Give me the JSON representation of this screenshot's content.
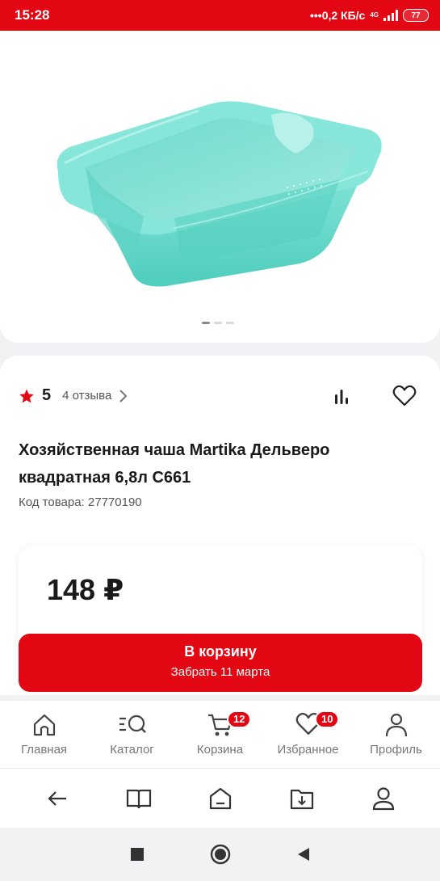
{
  "status_bar": {
    "time": "15:28",
    "speed": "•••0,2 КБ/с",
    "network": "4G",
    "battery": "77"
  },
  "gallery": {
    "image_alt": "Хозяйственная чаша бирюзовая",
    "dots": 3,
    "active_dot": 0
  },
  "product": {
    "rating": "5",
    "reviews": "4 отзыва",
    "title": "Хозяйственная чаша Martika Дельверо квадратная 6,8л С661",
    "code_label": "Код товара:",
    "code": "27770190",
    "price": "148 ₽"
  },
  "buy_button": {
    "label": "В корзину",
    "sub": "Забрать 11 марта"
  },
  "bottom_nav": [
    {
      "label": "Главная",
      "icon": "home-icon",
      "badge": ""
    },
    {
      "label": "Каталог",
      "icon": "catalog-search-icon",
      "badge": ""
    },
    {
      "label": "Корзина",
      "icon": "cart-icon",
      "badge": "12"
    },
    {
      "label": "Избранное",
      "icon": "heart-icon",
      "badge": "10"
    },
    {
      "label": "Профиль",
      "icon": "profile-icon",
      "badge": ""
    }
  ],
  "browser_bar": [
    "back-arrow-icon",
    "book-icon",
    "home-minus-icon",
    "download-folder-icon",
    "account-icon"
  ],
  "system_nav": [
    "recent-apps-icon",
    "home-circle-icon",
    "back-triangle-icon"
  ],
  "colors": {
    "accent": "#e30613",
    "product": "#5ed8c8"
  }
}
